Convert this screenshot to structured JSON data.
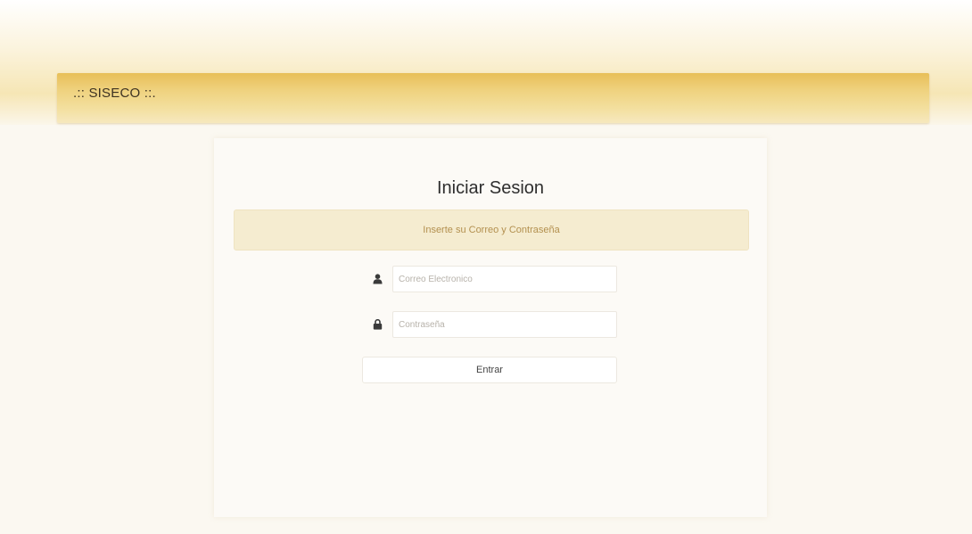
{
  "navbar": {
    "brand": ".:: SISECO ::."
  },
  "login": {
    "title": "Iniciar Sesion",
    "alert": "Inserte su Correo y Contraseña",
    "email": {
      "placeholder": "Correo Electronico",
      "icon": "user-icon"
    },
    "password": {
      "placeholder": "Contraseña",
      "icon": "lock-icon"
    },
    "submit_label": "Entrar"
  },
  "colors": {
    "navbar": "#efd27f",
    "alert_bg": "#f5ecd0",
    "alert_text": "#b3904f",
    "icon": "#3a3a3a"
  }
}
